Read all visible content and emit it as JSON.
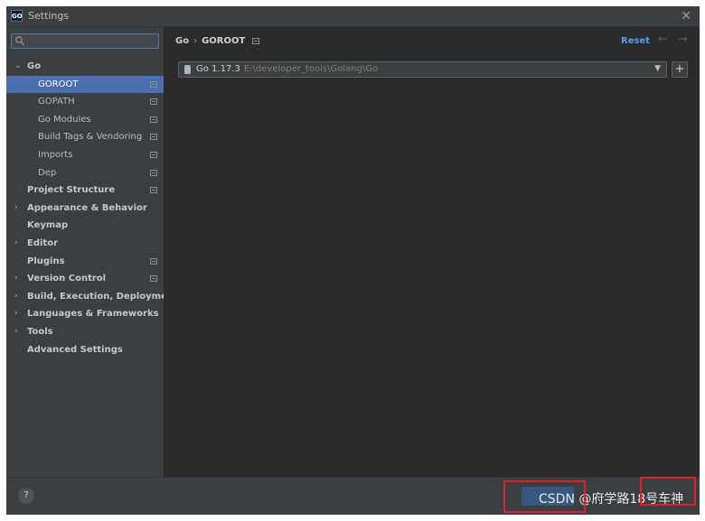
{
  "window": {
    "title": "Settings",
    "app_icon_text": "GO"
  },
  "search": {
    "placeholder": "",
    "value": ""
  },
  "sidebar": {
    "items": [
      {
        "label": "Go",
        "expanded": true
      },
      {
        "label": "GOROOT"
      },
      {
        "label": "GOPATH"
      },
      {
        "label": "Go Modules"
      },
      {
        "label": "Build Tags & Vendoring"
      },
      {
        "label": "Imports"
      },
      {
        "label": "Dep"
      },
      {
        "label": "Project Structure"
      },
      {
        "label": "Appearance & Behavior"
      },
      {
        "label": "Keymap"
      },
      {
        "label": "Editor"
      },
      {
        "label": "Plugins"
      },
      {
        "label": "Version Control"
      },
      {
        "label": "Build, Execution, Deployment"
      },
      {
        "label": "Languages & Frameworks"
      },
      {
        "label": "Tools"
      },
      {
        "label": "Advanced Settings"
      }
    ]
  },
  "breadcrumb": {
    "parent": "Go",
    "separator": "›",
    "current": "GOROOT"
  },
  "toolbar": {
    "reset_label": "Reset",
    "back_arrow": "←",
    "forward_arrow": "→"
  },
  "sdk": {
    "name": "Go 1.17.3",
    "path": "E:\\developer_tools\\Golang\\Go",
    "dropdown_glyph": "▼",
    "add_glyph": "+"
  },
  "footer": {
    "help_glyph": "?",
    "watermark": "CSDN @府学路18号车神"
  },
  "colors": {
    "selection": "#4b6eaf",
    "link": "#589df6",
    "highlight_box": "#e0202a"
  }
}
